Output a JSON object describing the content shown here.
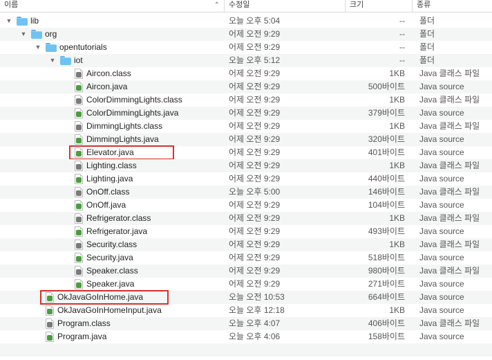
{
  "header": {
    "name_label": "이름",
    "date_label": "수정일",
    "size_label": "크기",
    "kind_label": "종류"
  },
  "rows": [
    {
      "name": "lib",
      "date": "오늘 오후 5:04",
      "size": "--",
      "kind": "폴더",
      "icon": "folder-icon",
      "expanded": true
    },
    {
      "name": "org",
      "date": "어제 오전 9:29",
      "size": "--",
      "kind": "폴더",
      "icon": "folder-icon",
      "expanded": true
    },
    {
      "name": "opentutorials",
      "date": "어제 오전 9:29",
      "size": "--",
      "kind": "폴더",
      "icon": "folder-icon",
      "expanded": true
    },
    {
      "name": "iot",
      "date": "오늘 오후 5:12",
      "size": "--",
      "kind": "폴더",
      "icon": "folder-icon",
      "expanded": true
    },
    {
      "name": "Aircon.class",
      "date": "어제 오전 9:29",
      "size": "1KB",
      "kind": "Java 클래스 파일",
      "icon": "class-file-icon"
    },
    {
      "name": "Aircon.java",
      "date": "어제 오전 9:29",
      "size": "500바이트",
      "kind": "Java source",
      "icon": "java-file-icon"
    },
    {
      "name": "ColorDimmingLights.class",
      "date": "어제 오전 9:29",
      "size": "1KB",
      "kind": "Java 클래스 파일",
      "icon": "class-file-icon"
    },
    {
      "name": "ColorDimmingLights.java",
      "date": "어제 오전 9:29",
      "size": "379바이트",
      "kind": "Java source",
      "icon": "java-file-icon"
    },
    {
      "name": "DimmingLights.class",
      "date": "어제 오전 9:29",
      "size": "1KB",
      "kind": "Java 클래스 파일",
      "icon": "class-file-icon"
    },
    {
      "name": "DimmingLights.java",
      "date": "어제 오전 9:29",
      "size": "320바이트",
      "kind": "Java source",
      "icon": "java-file-icon"
    },
    {
      "name": "Elevator.java",
      "date": "어제 오전 9:29",
      "size": "401바이트",
      "kind": "Java source",
      "icon": "java-file-icon",
      "highlighted": true
    },
    {
      "name": "Lighting.class",
      "date": "어제 오전 9:29",
      "size": "1KB",
      "kind": "Java 클래스 파일",
      "icon": "class-file-icon"
    },
    {
      "name": "Lighting.java",
      "date": "어제 오전 9:29",
      "size": "440바이트",
      "kind": "Java source",
      "icon": "java-file-icon"
    },
    {
      "name": "OnOff.class",
      "date": "오늘 오후 5:00",
      "size": "146바이트",
      "kind": "Java 클래스 파일",
      "icon": "class-file-icon"
    },
    {
      "name": "OnOff.java",
      "date": "어제 오전 9:29",
      "size": "104바이트",
      "kind": "Java source",
      "icon": "java-file-icon"
    },
    {
      "name": "Refrigerator.class",
      "date": "어제 오전 9:29",
      "size": "1KB",
      "kind": "Java 클래스 파일",
      "icon": "class-file-icon"
    },
    {
      "name": "Refrigerator.java",
      "date": "어제 오전 9:29",
      "size": "493바이트",
      "kind": "Java source",
      "icon": "java-file-icon"
    },
    {
      "name": "Security.class",
      "date": "어제 오전 9:29",
      "size": "1KB",
      "kind": "Java 클래스 파일",
      "icon": "class-file-icon"
    },
    {
      "name": "Security.java",
      "date": "어제 오전 9:29",
      "size": "518바이트",
      "kind": "Java source",
      "icon": "java-file-icon"
    },
    {
      "name": "Speaker.class",
      "date": "어제 오전 9:29",
      "size": "980바이트",
      "kind": "Java 클래스 파일",
      "icon": "class-file-icon"
    },
    {
      "name": "Speaker.java",
      "date": "어제 오전 9:29",
      "size": "271바이트",
      "kind": "Java source",
      "icon": "java-file-icon"
    },
    {
      "name": "OkJavaGoInHome.java",
      "date": "오늘 오전 10:53",
      "size": "664바이트",
      "kind": "Java source",
      "icon": "java-file-icon",
      "highlighted": true
    },
    {
      "name": "OkJavaGoInHomeInput.java",
      "date": "오늘 오후 12:18",
      "size": "1KB",
      "kind": "Java source",
      "icon": "java-file-icon"
    },
    {
      "name": "Program.class",
      "date": "오늘 오후 4:07",
      "size": "406바이트",
      "kind": "Java 클래스 파일",
      "icon": "class-file-icon"
    },
    {
      "name": "Program.java",
      "date": "오늘 오후 4:06",
      "size": "158바이트",
      "kind": "Java source",
      "icon": "java-file-icon"
    }
  ],
  "colors": {
    "highlight_border": "#d9302a",
    "folder": "#6ec2f4",
    "java_badge": "#4b9e3f"
  }
}
